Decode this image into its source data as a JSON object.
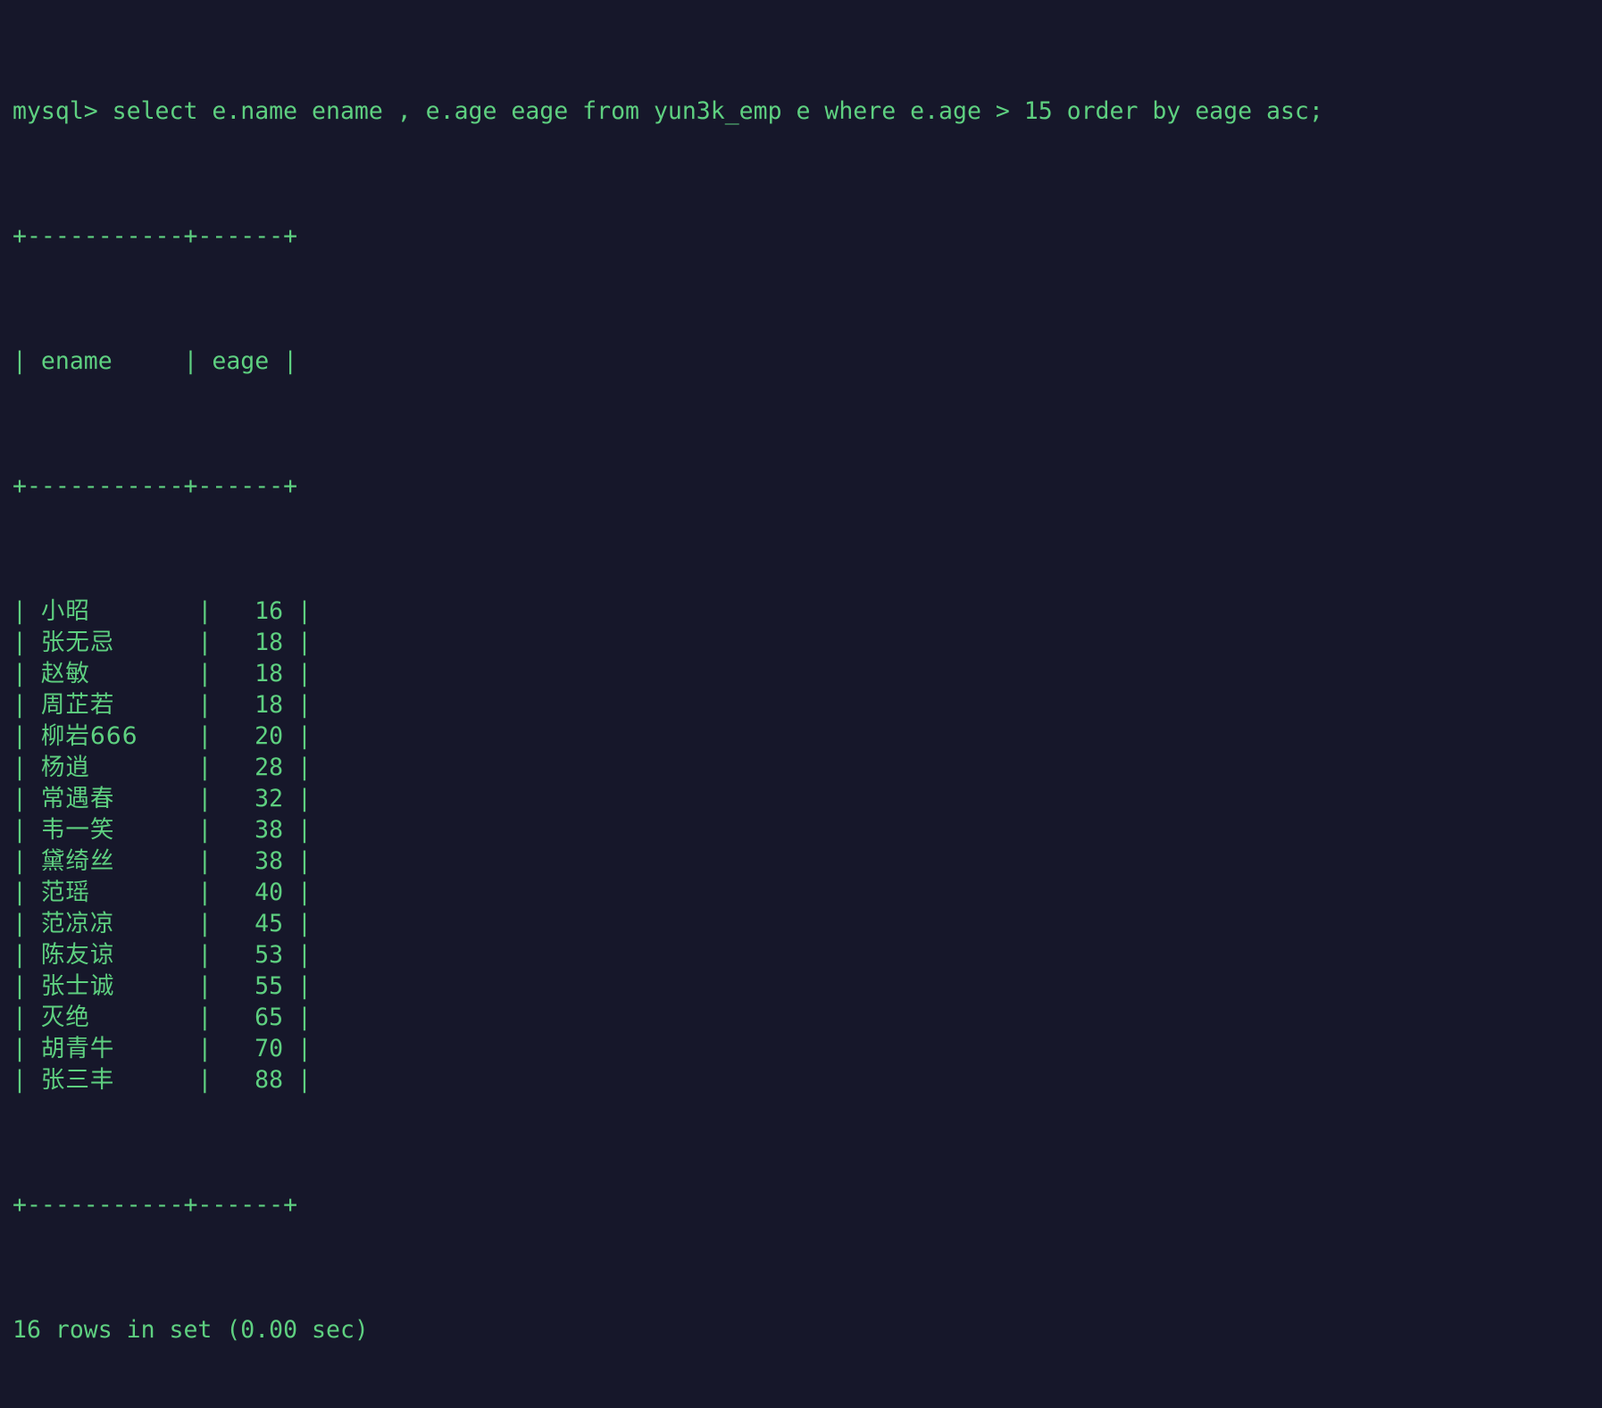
{
  "terminal": {
    "background_color": "#16172a",
    "text_color": "#5ed080",
    "prompt": "mysql> ",
    "query": "select e.name ename , e.age eage from yun3k_emp e where e.age > 15 order by eage asc;",
    "prompt_line": "mysql> select e.name ename , e.age eage from yun3k_emp e where e.age > 15 order by eage asc;"
  },
  "result_table": {
    "separator": "+-----------+------+",
    "columns": [
      {
        "name": "ename",
        "width": 11,
        "align": "left"
      },
      {
        "name": "eage",
        "width": 6,
        "align": "right"
      }
    ],
    "header_line": "| ename     | eage |",
    "rows": [
      {
        "ename": "小昭",
        "eage": "16"
      },
      {
        "ename": "张无忌",
        "eage": "18"
      },
      {
        "ename": "赵敏",
        "eage": "18"
      },
      {
        "ename": "周芷若",
        "eage": "18"
      },
      {
        "ename": "柳岩666",
        "eage": "20"
      },
      {
        "ename": "杨逍",
        "eage": "28"
      },
      {
        "ename": "常遇春",
        "eage": "32"
      },
      {
        "ename": "韦一笑",
        "eage": "38"
      },
      {
        "ename": "黛绮丝",
        "eage": "38"
      },
      {
        "ename": "范瑶",
        "eage": "40"
      },
      {
        "ename": "范凉凉",
        "eage": "45"
      },
      {
        "ename": "陈友谅",
        "eage": "53"
      },
      {
        "ename": "张士诚",
        "eage": "55"
      },
      {
        "ename": "灭绝",
        "eage": "65"
      },
      {
        "ename": "胡青牛",
        "eage": "70"
      },
      {
        "ename": "张三丰",
        "eage": "88"
      }
    ],
    "row_count": 16,
    "elapsed": "0.00 sec",
    "footer": "16 rows in set (0.00 sec)"
  }
}
